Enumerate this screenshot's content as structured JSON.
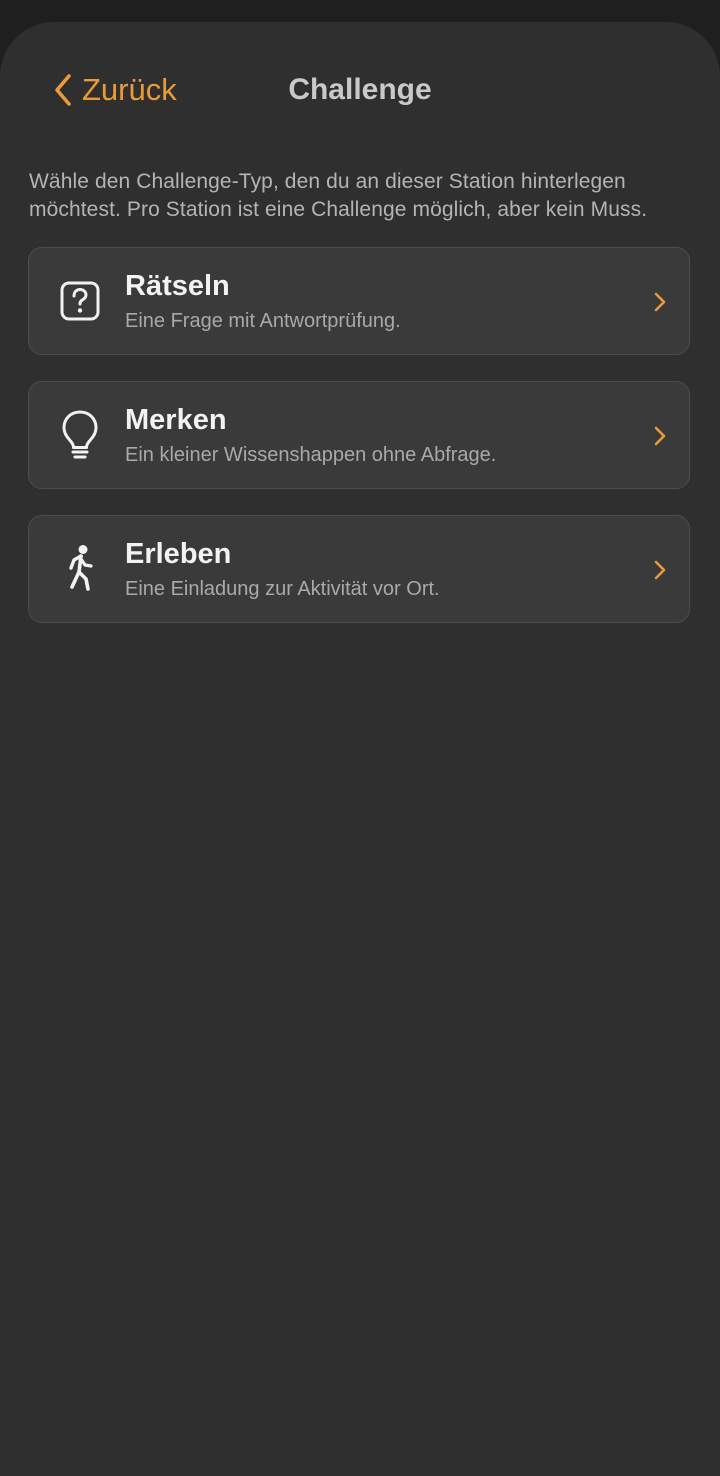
{
  "nav": {
    "back_label": "Zurück",
    "title": "Challenge"
  },
  "intro_text": "Wähle den Challenge-Typ, den du an dieser Station hinterlegen möchtest. Pro Station ist eine Challenge möglich, aber kein Muss.",
  "options": [
    {
      "title": "Rätseln",
      "subtitle": "Eine Frage mit Antwortprüfung.",
      "icon": "question-square-icon"
    },
    {
      "title": "Merken",
      "subtitle": "Ein kleiner Wissenshappen ohne Abfrage.",
      "icon": "lightbulb-icon"
    },
    {
      "title": "Erleben",
      "subtitle": "Eine Einladung zur Aktivität vor Ort.",
      "icon": "walking-person-icon"
    }
  ],
  "colors": {
    "accent": "#e99a3a",
    "background": "#2f2f2f",
    "card": "#3a3a3a"
  }
}
